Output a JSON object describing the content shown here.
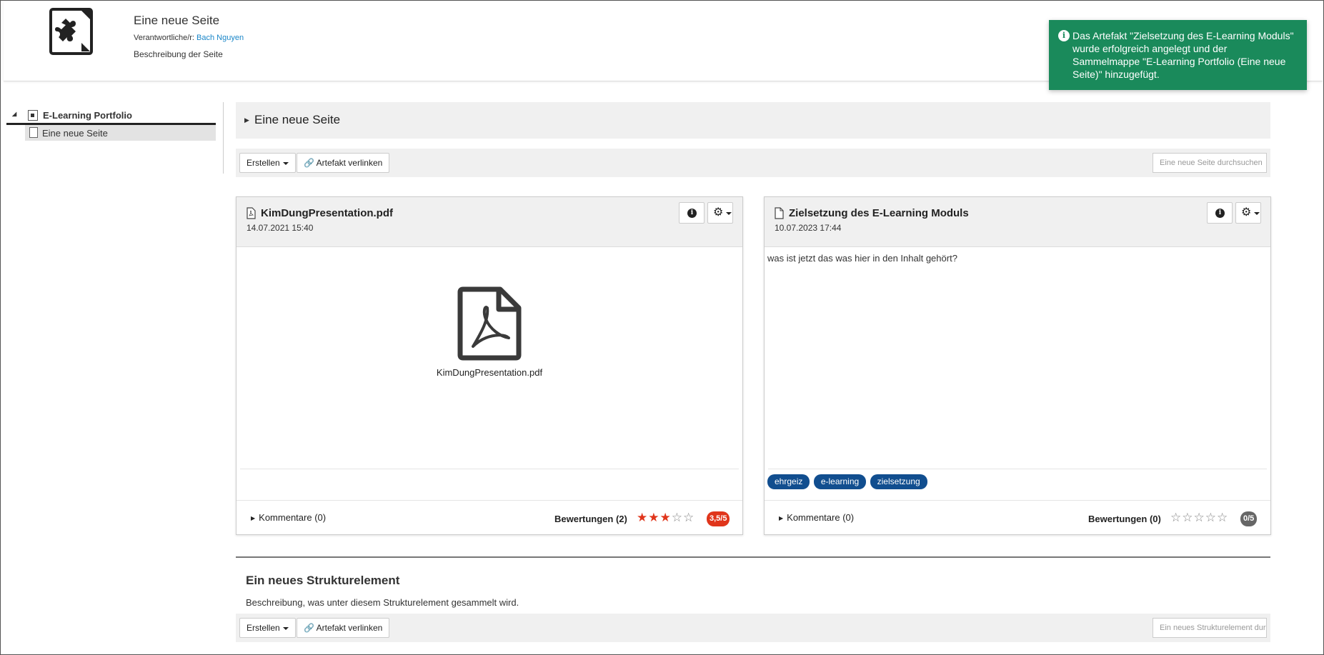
{
  "header": {
    "title": "Eine neue Seite",
    "owner_label": "Verantwortliche/r:",
    "owner_name": "Bach Nguyen",
    "description": "Beschreibung der Seite"
  },
  "toast": {
    "message": "Das Artefakt \"Zielsetzung des E-Learning Moduls\" wurde erfolgreich angelegt und der Sammelmappe \"E-Learning Portfolio (Eine neue Seite)\" hinzugefügt."
  },
  "sidebar": {
    "root_label": "E-Learning Portfolio",
    "child_label": "Eine neue Seite"
  },
  "section": {
    "title": "Eine neue Seite",
    "create_label": "Erstellen",
    "link_label": "Artefakt verlinken",
    "search_placeholder": "Eine neue Seite durchsuchen"
  },
  "cards": [
    {
      "title": "KimDungPresentation.pdf",
      "date": "14.07.2021 15:40",
      "preview_caption": "KimDungPresentation.pdf",
      "comments_label": "Kommentare (0)",
      "ratings_label": "Bewertungen (2)",
      "rating_value": 3,
      "rating_max": 5,
      "rating_badge": "3,5/5",
      "badge_color": "#e0351b"
    },
    {
      "title": "Zielsetzung des E-Learning Moduls",
      "date": "10.07.2023 17:44",
      "body": "was ist jetzt das was hier in den Inhalt gehört?",
      "tags": [
        "ehrgeiz",
        "e-learning",
        "zielsetzung"
      ],
      "comments_label": "Kommentare (0)",
      "ratings_label": "Bewertungen (0)",
      "rating_value": 0,
      "rating_max": 5,
      "rating_badge": "0/5",
      "badge_color": "#666666"
    }
  ],
  "structure": {
    "title": "Ein neues Strukturelement",
    "description": "Beschreibung, was unter diesem Strukturelement gesammelt wird.",
    "create_label": "Erstellen",
    "link_label": "Artefakt verlinken",
    "search_placeholder": "Ein neues Strukturelement durchsuchen"
  },
  "colors": {
    "toast_bg": "#1a8a5b",
    "tag_bg": "#114e8f",
    "link": "#1a86c8"
  }
}
